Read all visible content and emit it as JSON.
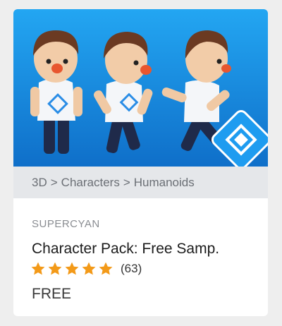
{
  "product": {
    "publisher": "SUPERCYAN",
    "title": "Character Pack: Free Samp.",
    "rating_count": "(63)",
    "rating_stars": 5,
    "price": "FREE"
  },
  "breadcrumb": [
    "3D",
    "Characters",
    "Humanoids"
  ],
  "breadcrumb_separator": ">",
  "icons": {
    "star": "star-icon",
    "logo": "supercyan-logo"
  },
  "colors": {
    "hero_bg": "#1a8de3",
    "star": "#f39a19",
    "shirt": "#ffffff",
    "hair": "#6b3a22",
    "pants": "#1f2a4a",
    "logo_bg": "#1e9cf0"
  }
}
